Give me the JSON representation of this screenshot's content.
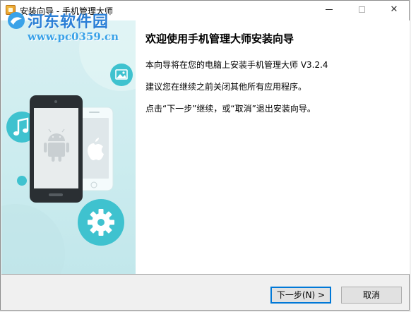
{
  "window": {
    "title": "安装向导 - 手机管理大师"
  },
  "watermark": {
    "title": "河东软件园",
    "url": "www.pc0359.cn"
  },
  "content": {
    "heading": "欢迎使用手机管理大师安装向导",
    "line1": "本向导将在您的电脑上安装手机管理大师 V3.2.4",
    "line2": "建议您在继续之前关闭其他所有应用程序。",
    "line3": "点击“下一步”继续，或“取消”退出安装向导。"
  },
  "buttons": {
    "next_label": "下一步(N) >",
    "cancel_label": "取消"
  },
  "controls": {
    "minimize": "minimize",
    "maximize": "maximize",
    "close": "✕"
  },
  "colors": {
    "accent": "#0078d7",
    "panel": "#ccecef",
    "circle": "#3fc2cf",
    "phone": "#2a2f33"
  },
  "icons": [
    "app-icon",
    "watermark-logo-icon",
    "music-note-icon",
    "image-icon",
    "gear-icon",
    "android-icon",
    "apple-icon"
  ]
}
